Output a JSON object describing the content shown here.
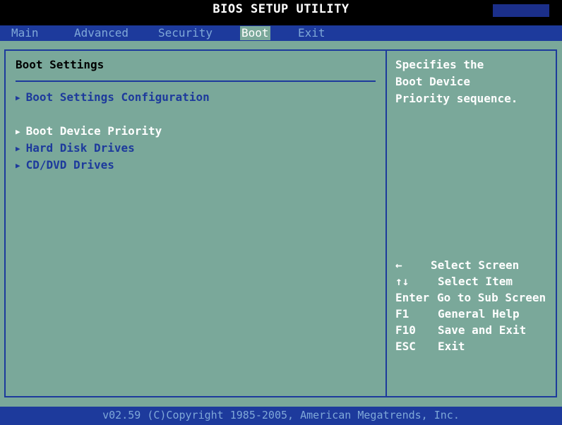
{
  "title": "BIOS SETUP UTILITY",
  "menu": [
    {
      "label": "Main"
    },
    {
      "label": "Advanced"
    },
    {
      "label": "Security"
    },
    {
      "label": "Boot"
    },
    {
      "label": "Exit"
    }
  ],
  "active_menu": "Boot",
  "boot_panel": {
    "heading": "Boot Settings",
    "items": [
      {
        "label": "Boot Settings Configuration"
      },
      {
        "label": "Boot Device Priority"
      },
      {
        "label": "Hard Disk Drives"
      },
      {
        "label": "CD/DVD Drives"
      }
    ],
    "selected_item": "Boot Device Priority"
  },
  "help": {
    "lines": [
      "Specifies the",
      "Boot Device",
      "Priority sequence."
    ]
  },
  "keys": [
    {
      "key": "←",
      "desc": "Select Screen"
    },
    {
      "key": "↑↓",
      "desc": "Select Item"
    },
    {
      "key": "Enter",
      "desc": "Go to Sub Screen"
    },
    {
      "key": "F1",
      "desc": "General Help"
    },
    {
      "key": "F10",
      "desc": "Save and Exit"
    },
    {
      "key": "ESC",
      "desc": "Exit"
    }
  ],
  "footer": "v02.59 (C)Copyright 1985-2005, American Megatrends, Inc.",
  "colors": {
    "background": "#7aa89a",
    "bar": "#1d3a9c",
    "highlight": "#ffffff",
    "item_text": "#1d3a9c"
  }
}
